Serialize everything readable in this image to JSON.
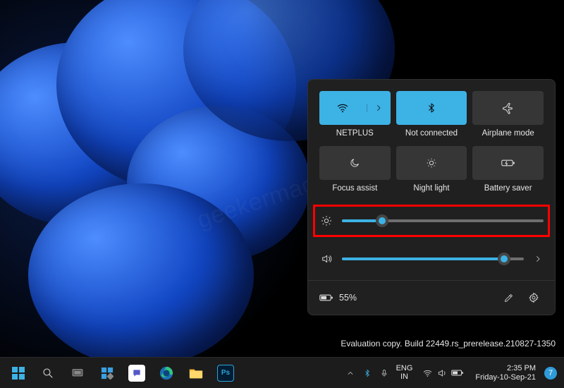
{
  "quick_settings": {
    "tiles": [
      {
        "id": "wifi",
        "label": "NETPLUS",
        "active": true,
        "has_expand": true
      },
      {
        "id": "bluetooth",
        "label": "Not connected",
        "active": true,
        "has_expand": false
      },
      {
        "id": "airplane",
        "label": "Airplane mode",
        "active": false,
        "has_expand": false
      },
      {
        "id": "focus",
        "label": "Focus assist",
        "active": false,
        "has_expand": false
      },
      {
        "id": "night",
        "label": "Night light",
        "active": false,
        "has_expand": false
      },
      {
        "id": "battery",
        "label": "Battery saver",
        "active": false,
        "has_expand": false
      }
    ],
    "brightness_percent": 20,
    "volume_percent": 89,
    "battery_text": "55%"
  },
  "desktop": {
    "evaluation_line": "Evaluation copy. Build 22449.rs_prerelease.210827-1350",
    "watermark": "geekermag.com"
  },
  "taskbar": {
    "tray_chevron": "^",
    "language_primary": "ENG",
    "language_secondary": "IN",
    "clock_time": "2:35 PM",
    "clock_date": "Friday-10-Sep-21",
    "notification_count": "7"
  }
}
